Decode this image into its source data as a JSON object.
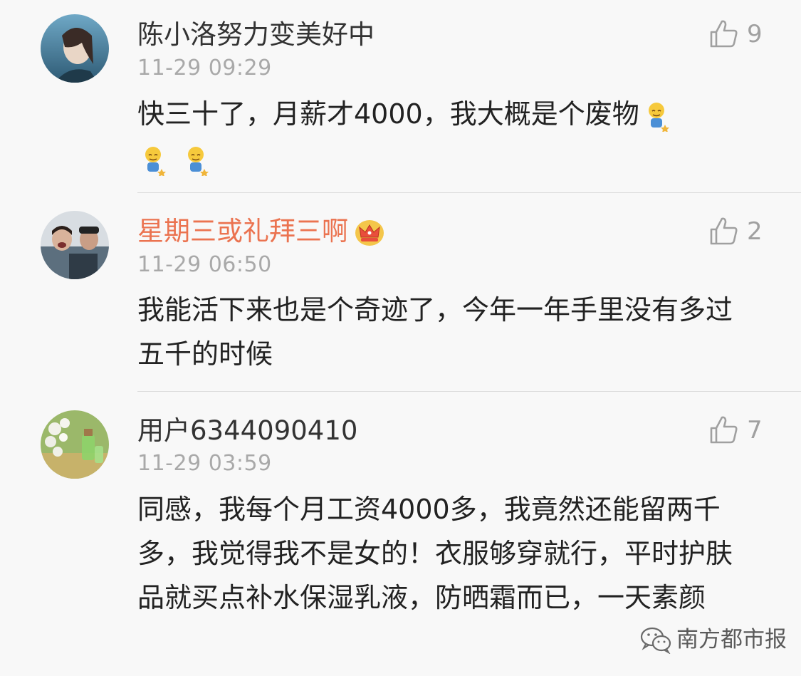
{
  "comments": [
    {
      "username": "陈小洛努力变美好中",
      "time": "11-29 09:29",
      "likes": "9",
      "text": "快三十了，月薪才4000，我大概是个废物",
      "emoji": "sweat-smile-emoji"
    },
    {
      "username": "星期三或礼拜三啊",
      "time": "11-29 06:50",
      "likes": "2",
      "text": "我能活下来也是个奇迹了，今年一年手里没有多过五千的时候"
    },
    {
      "username": "用户6344090410",
      "time": "11-29 03:59",
      "likes": "7",
      "text": "同感，我每个月工资4000多，我竟然还能留两千多，我觉得我不是女的！衣服够穿就行，平时护肤品就买点补水保湿乳液，防晒霜而已，一天素颜"
    }
  ],
  "watermark": {
    "text": "南方都市报"
  },
  "colors": {
    "vip_name": "#eb7350",
    "time": "#a9a9a9",
    "text": "#222222",
    "background": "#f8f8f8"
  }
}
